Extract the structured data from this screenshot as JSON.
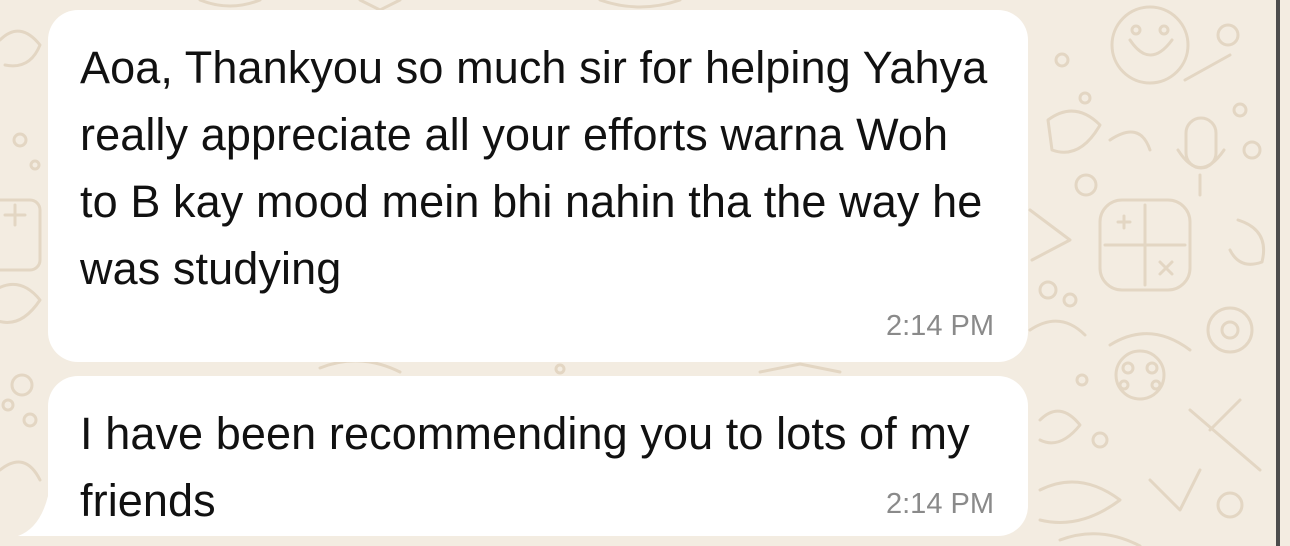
{
  "chat": {
    "messages": [
      {
        "text": "Aoa, Thankyou so much sir for helping Yahya really appreciate all your efforts warna Woh to B kay mood mein bhi nahin tha the way he was studying",
        "time": "2:14 PM"
      },
      {
        "text": "I have been recommending you to lots of my friends",
        "time": "2:14 PM"
      }
    ]
  },
  "colors": {
    "wallpaper": "#f3ece1",
    "doodle": "#e3d6c3",
    "bubble": "#ffffff",
    "text": "#111111",
    "timestamp": "#8a8a8a"
  }
}
